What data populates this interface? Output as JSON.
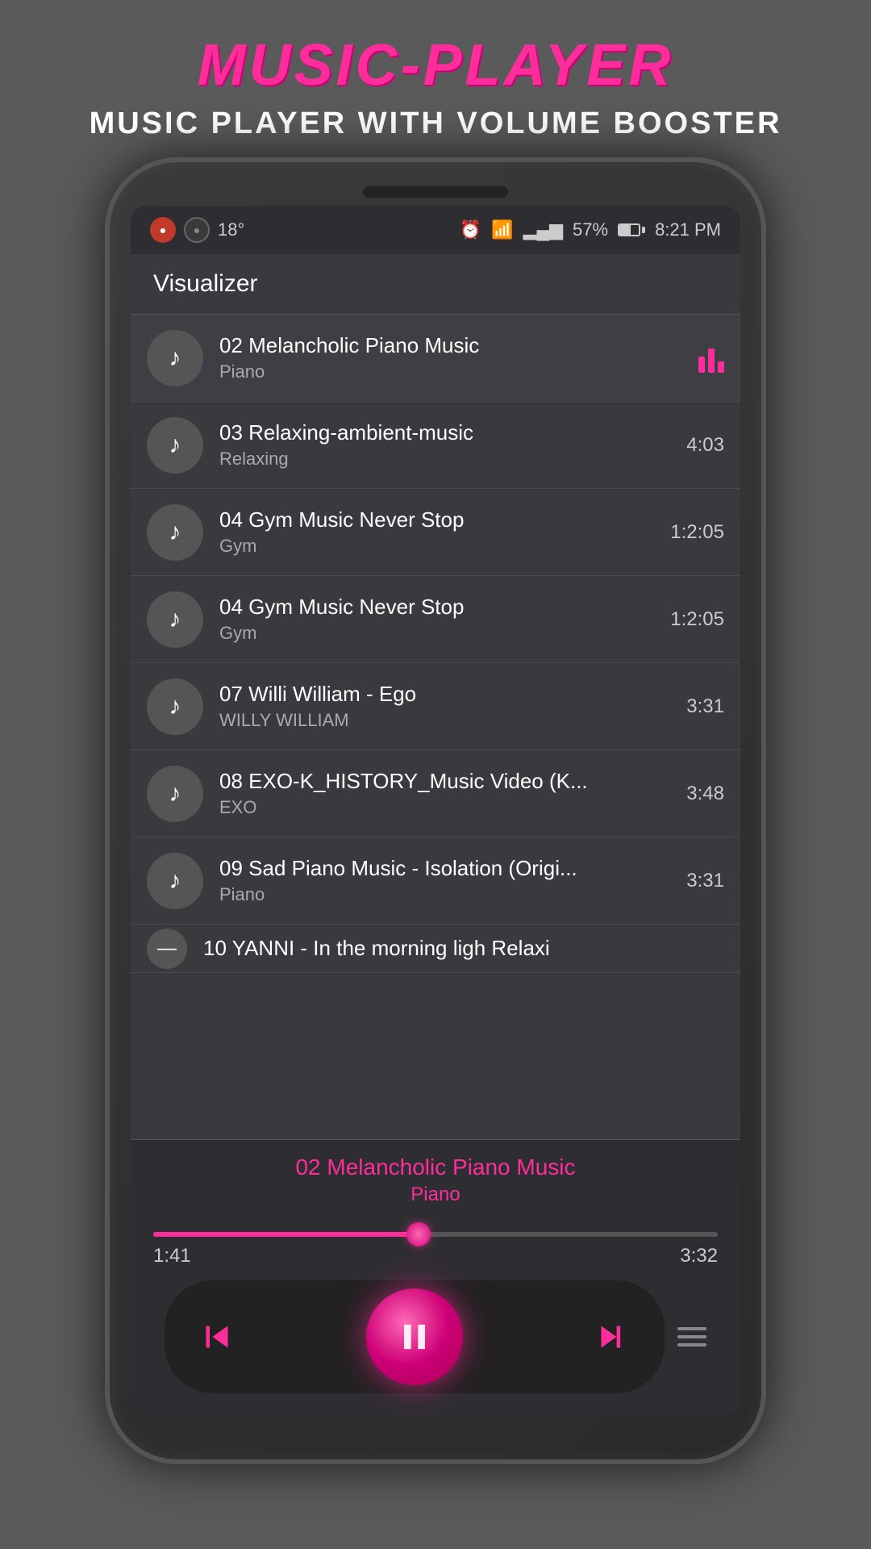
{
  "header": {
    "logo": "MUSIC-PLAYER",
    "subtitle": "MUSIC PLAYER WITH VOLUME BOOSTER"
  },
  "status_bar": {
    "temperature": "18°",
    "battery_percent": "57%",
    "time": "8:21 PM"
  },
  "visualizer_label": "Visualizer",
  "tracks": [
    {
      "number": "02",
      "title": "02 Melancholic Piano Music",
      "artist": "Piano",
      "duration": "",
      "active": true
    },
    {
      "number": "03",
      "title": "03 Relaxing-ambient-music",
      "artist": "Relaxing",
      "duration": "4:03",
      "active": false
    },
    {
      "number": "04a",
      "title": "04 Gym Music Never Stop",
      "artist": "Gym",
      "duration": "1:2:05",
      "active": false
    },
    {
      "number": "04b",
      "title": "04 Gym Music Never Stop",
      "artist": "Gym",
      "duration": "1:2:05",
      "active": false
    },
    {
      "number": "07",
      "title": "07 Willi William - Ego",
      "artist": "WILLY WILLIAM",
      "duration": "3:31",
      "active": false
    },
    {
      "number": "08",
      "title": "08 EXO-K_HISTORY_Music Video (K...",
      "artist": "EXO",
      "duration": "3:48",
      "active": false
    },
    {
      "number": "09",
      "title": "09 Sad Piano Music - Isolation (Origi...",
      "artist": "Piano",
      "duration": "3:31",
      "active": false
    },
    {
      "number": "10",
      "title": "10 YANNI - In the morning ligh Relaxi",
      "artist": "",
      "duration": "",
      "active": false,
      "partial": true
    }
  ],
  "now_playing": {
    "title": "02 Melancholic Piano Music",
    "artist": "Piano",
    "current_time": "1:41",
    "total_time": "3:32",
    "progress_percent": 47
  },
  "controls": {
    "prev_label": "previous",
    "play_pause_label": "pause",
    "next_label": "next"
  }
}
